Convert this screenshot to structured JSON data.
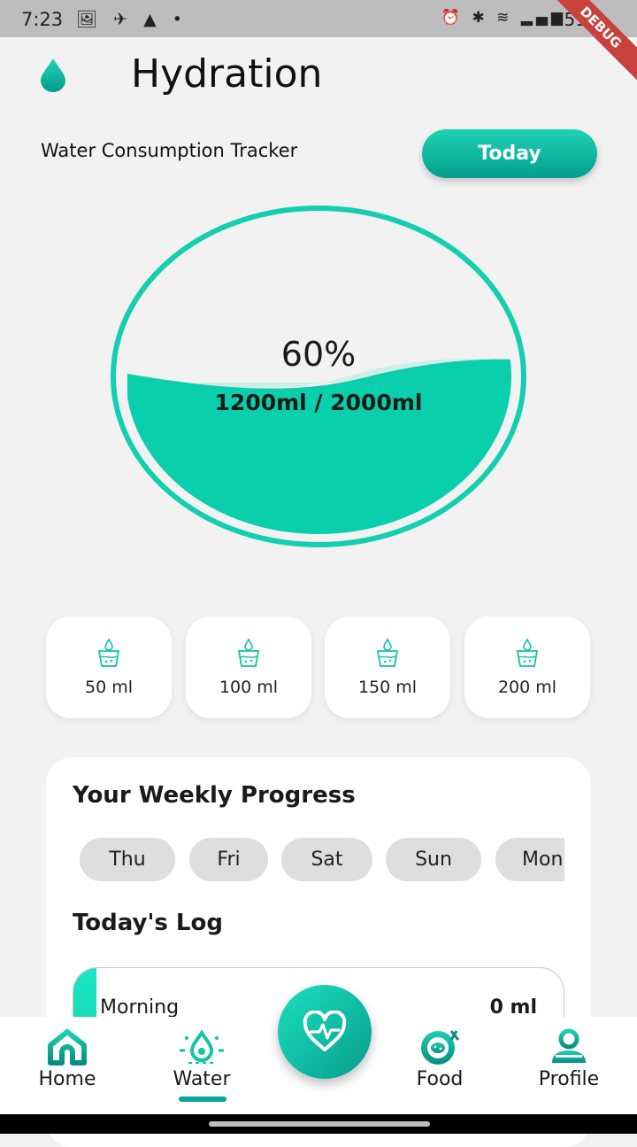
{
  "status_bar": {
    "time": "7:23",
    "battery": "51%",
    "debug_banner": "DEBUG"
  },
  "header": {
    "title": "Hydration",
    "subtitle": "Water Consumption Tracker",
    "today_button": "Today"
  },
  "gauge": {
    "percent_text": "60%",
    "amount_text": "1200ml / 2000ml",
    "fill_fraction": 0.6,
    "accent_color": "#0acfac"
  },
  "quick_add": [
    {
      "label": "50 ml"
    },
    {
      "label": "100 ml"
    },
    {
      "label": "150 ml"
    },
    {
      "label": "200 ml"
    }
  ],
  "weekly": {
    "title": "Your Weekly Progress",
    "days": [
      "Thu",
      "Fri",
      "Sat",
      "Sun",
      "Mon"
    ]
  },
  "todays_log": {
    "title": "Today's Log",
    "items": [
      {
        "label": "Morning",
        "value": "0 ml"
      }
    ]
  },
  "bottom_nav": {
    "items": [
      {
        "label": "Home",
        "icon": "home-icon"
      },
      {
        "label": "Water",
        "icon": "water-drop-icon",
        "active": true
      },
      {
        "label": "Food",
        "icon": "food-plate-icon"
      },
      {
        "label": "Profile",
        "icon": "profile-icon"
      }
    ],
    "fab_icon": "heart-pulse-icon"
  }
}
